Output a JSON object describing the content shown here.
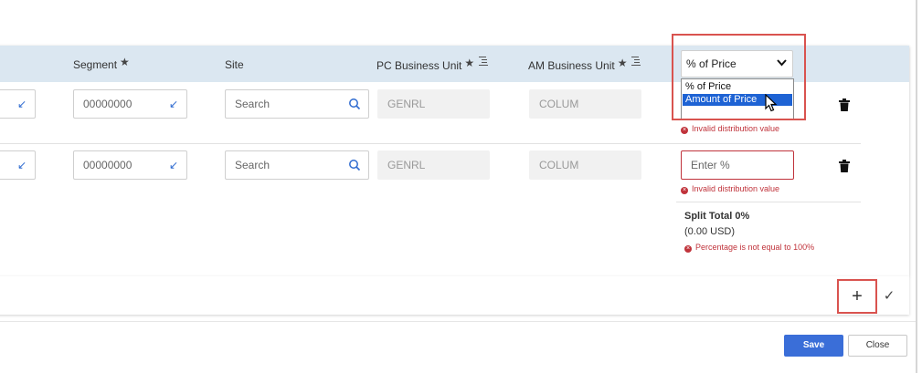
{
  "columns": {
    "segment": "Segment",
    "site": "Site",
    "pc_business_unit": "PC Business Unit",
    "am_business_unit": "AM Business Unit"
  },
  "distribution_type": {
    "selected": "% of Price",
    "options": [
      "% of Price",
      "Amount of Price"
    ],
    "highlighted": "Amount of Price"
  },
  "rows": [
    {
      "segment": "00000000",
      "site_placeholder": "Search",
      "pc_business_unit": "GENRL",
      "am_business_unit": "COLUM",
      "distribution_placeholder": "",
      "error": "Invalid distribution value"
    },
    {
      "segment": "00000000",
      "site_placeholder": "Search",
      "pc_business_unit": "GENRL",
      "am_business_unit": "COLUM",
      "distribution_placeholder": "Enter %",
      "error": "Invalid distribution value"
    }
  ],
  "split": {
    "title": "Split Total 0%",
    "amount": "(0.00 USD)",
    "error": "Percentage is not equal to 100%"
  },
  "footer": {
    "save_label": "Save",
    "close_label": "Close"
  },
  "icons": {
    "add": "plus-icon",
    "confirm": "check-icon",
    "delete": "trash-icon"
  },
  "colors": {
    "accent": "#3a6ed8",
    "error": "#c0333b",
    "highlight_box": "#d9534f",
    "header_band": "#dbe7f1"
  }
}
